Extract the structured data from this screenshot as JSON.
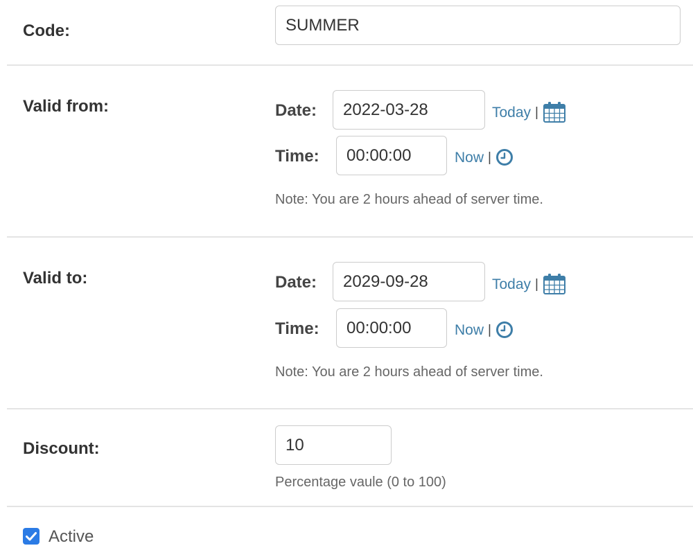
{
  "code": {
    "label": "Code:",
    "value": "SUMMER"
  },
  "valid_from": {
    "label": "Valid from:",
    "date_label": "Date:",
    "date_value": "2022-03-28",
    "today_link": "Today",
    "separator": "|",
    "time_label": "Time:",
    "time_value": "00:00:00",
    "now_link": "Now",
    "note": "Note: You are 2 hours ahead of server time."
  },
  "valid_to": {
    "label": "Valid to:",
    "date_label": "Date:",
    "date_value": "2029-09-28",
    "today_link": "Today",
    "separator": "|",
    "time_label": "Time:",
    "time_value": "00:00:00",
    "now_link": "Now",
    "note": "Note: You are 2 hours ahead of server time."
  },
  "discount": {
    "label": "Discount:",
    "value": "10",
    "help": "Percentage vaule (0 to 100)"
  },
  "active": {
    "label": "Active",
    "checked": true
  },
  "colors": {
    "link": "#3e7ea8",
    "checkbox": "#2b7be5",
    "divider": "#e4e4e4"
  },
  "icons": [
    "calendar-icon",
    "clock-icon",
    "checkmark-icon"
  ]
}
